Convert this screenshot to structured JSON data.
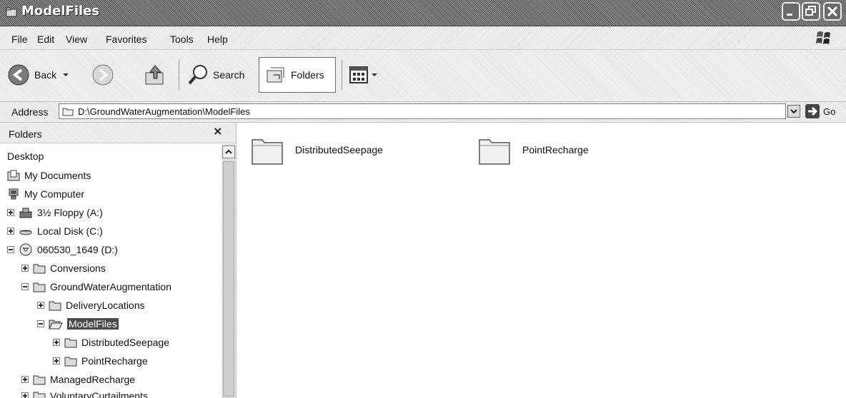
{
  "window": {
    "title": "ModelFiles",
    "controls": [
      "minimize-icon",
      "maximize-icon",
      "close-icon"
    ]
  },
  "menu": {
    "items": [
      "File",
      "Edit",
      "View",
      "Favorites",
      "Tools",
      "Help"
    ]
  },
  "toolbar": {
    "back_label": "Back",
    "search_label": "Search",
    "folders_label": "Folders"
  },
  "address": {
    "label": "Address",
    "value": "D:\\GroundWaterAugmentation\\ModelFiles",
    "go_label": "Go"
  },
  "folders_pane": {
    "title": "Folders",
    "close_glyph": "×",
    "tree": [
      {
        "label": "Desktop",
        "icon": "none",
        "expander": "none"
      },
      {
        "label": "My Documents",
        "icon": "my-documents-icon",
        "expander": "none"
      },
      {
        "label": "My Computer",
        "icon": "my-computer-icon",
        "expander": "none"
      },
      {
        "label": "3½ Floppy (A:)",
        "icon": "floppy-drive-icon",
        "expander": "plus"
      },
      {
        "label": "Local Disk (C:)",
        "icon": "hard-disk-icon",
        "expander": "plus"
      },
      {
        "label": "060530_1649 (D:)",
        "icon": "cd-drive-icon",
        "expander": "minus"
      },
      {
        "label": "Conversions",
        "icon": "folder-icon",
        "expander": "plus"
      },
      {
        "label": "GroundWaterAugmentation",
        "icon": "folder-icon",
        "expander": "minus"
      },
      {
        "label": "DeliveryLocations",
        "icon": "folder-icon",
        "expander": "plus"
      },
      {
        "label": "ModelFiles",
        "icon": "open-folder-icon",
        "expander": "minus",
        "selected": true
      },
      {
        "label": "DistributedSeepage",
        "icon": "folder-icon",
        "expander": "plus"
      },
      {
        "label": "PointRecharge",
        "icon": "folder-icon",
        "expander": "plus"
      },
      {
        "label": "ManagedRecharge",
        "icon": "folder-icon",
        "expander": "plus"
      },
      {
        "label": "VoluntaryCurtailments",
        "icon": "folder-icon",
        "expander": "plus"
      }
    ]
  },
  "content": {
    "items": [
      {
        "label": "DistributedSeepage",
        "icon": "large-folder-icon"
      },
      {
        "label": "PointRecharge",
        "icon": "large-folder-icon"
      }
    ]
  }
}
